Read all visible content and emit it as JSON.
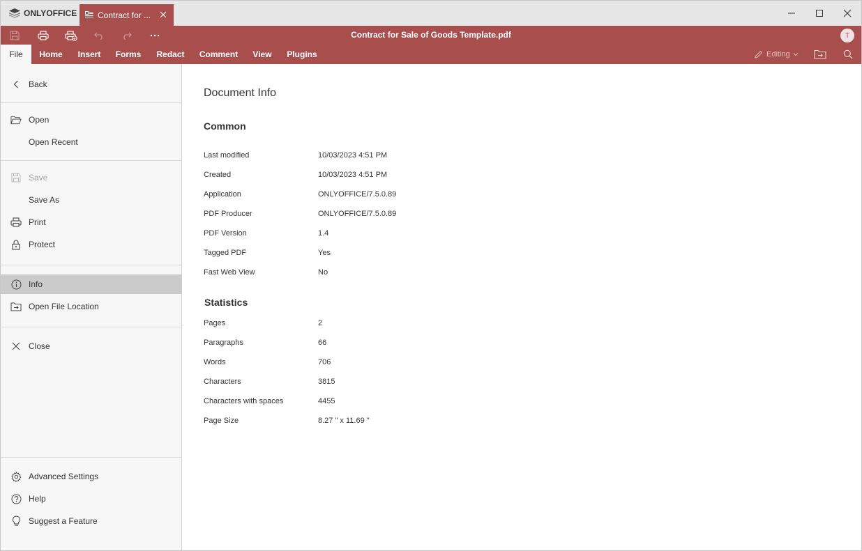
{
  "app": {
    "brand": "ONLYOFFICE",
    "accent_color": "#a84f4e"
  },
  "tab": {
    "label": "Contract for ..."
  },
  "toolbar": {
    "doc_title": "Contract for Sale of Goods Template.pdf",
    "avatar_initial": "T"
  },
  "menu": {
    "tabs": [
      "File",
      "Home",
      "Insert",
      "Forms",
      "Redact",
      "Comment",
      "View",
      "Plugins"
    ],
    "editing_label": "Editing"
  },
  "left_panel": {
    "back": "Back",
    "open": "Open",
    "open_recent": "Open Recent",
    "save": "Save",
    "save_as": "Save As",
    "print": "Print",
    "protect": "Protect",
    "info": "Info",
    "open_file_location": "Open File Location",
    "close": "Close",
    "advanced_settings": "Advanced Settings",
    "help": "Help",
    "suggest_feature": "Suggest a Feature"
  },
  "content": {
    "title": "Document Info",
    "common_title": "Common",
    "common": [
      {
        "label": "Last modified",
        "value": "10/03/2023 4:51 PM"
      },
      {
        "label": "Created",
        "value": "10/03/2023 4:51 PM"
      },
      {
        "label": "Application",
        "value": "ONLYOFFICE/7.5.0.89"
      },
      {
        "label": "PDF Producer",
        "value": "ONLYOFFICE/7.5.0.89"
      },
      {
        "label": "PDF Version",
        "value": "1.4"
      },
      {
        "label": "Tagged PDF",
        "value": "Yes"
      },
      {
        "label": "Fast Web View",
        "value": "No"
      }
    ],
    "statistics_title": "Statistics",
    "statistics": [
      {
        "label": "Pages",
        "value": "2"
      },
      {
        "label": "Paragraphs",
        "value": "66"
      },
      {
        "label": "Words",
        "value": "706"
      },
      {
        "label": "Characters",
        "value": "3815"
      },
      {
        "label": "Characters with spaces",
        "value": "4455"
      },
      {
        "label": "Page Size",
        "value": "8.27 \" x 11.69 \""
      }
    ]
  }
}
